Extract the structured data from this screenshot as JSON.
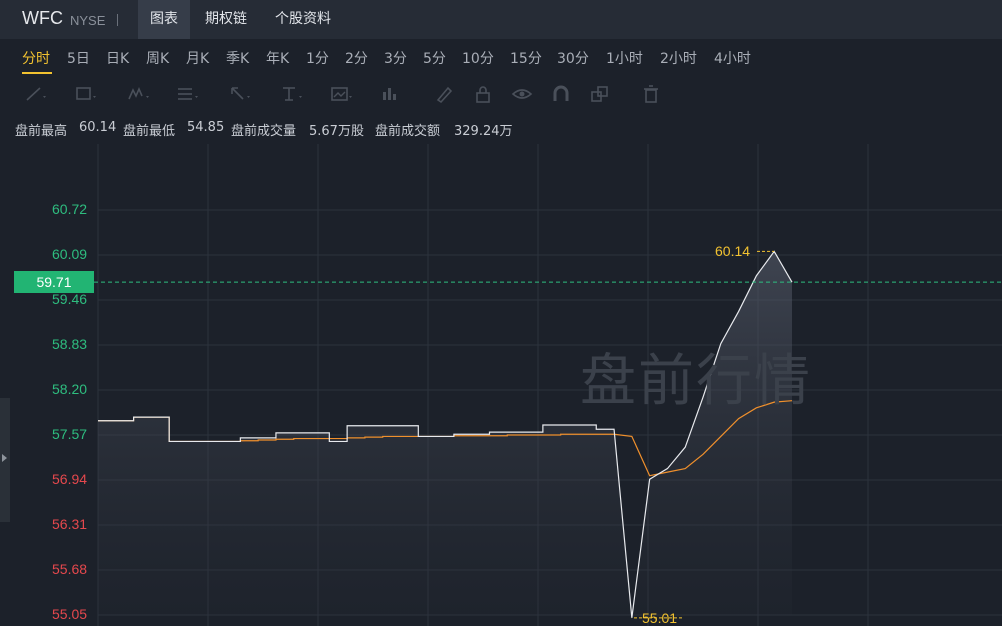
{
  "header": {
    "ticker": "WFC",
    "exchange": "NYSE",
    "tabs": [
      {
        "label": "图表",
        "active": true
      },
      {
        "label": "期权链",
        "active": false
      },
      {
        "label": "个股资料",
        "active": false
      }
    ]
  },
  "periods": [
    "分时",
    "5日",
    "日K",
    "周K",
    "月K",
    "季K",
    "年K",
    "1分",
    "2分",
    "3分",
    "5分",
    "10分",
    "15分",
    "30分",
    "1小时",
    "2小时",
    "4小时"
  ],
  "active_period": "分时",
  "toolbar_icons": [
    "line-tool-icon",
    "rectangle-tool-icon",
    "wave-tool-icon",
    "fibonacci-tool-icon",
    "arrow-tool-icon",
    "text-tool-icon",
    "image-tool-icon",
    "measure-tool-icon",
    "brush-icon",
    "lock-icon",
    "eye-icon",
    "magnet-icon",
    "layers-icon",
    "trash-icon"
  ],
  "stats": {
    "high_label": "盘前最高",
    "high_value": "60.14",
    "low_label": "盘前最低",
    "low_value": "54.85",
    "volume_label": "盘前成交量",
    "volume_value": "5.67万股",
    "amount_label": "盘前成交额",
    "amount_value": "329.24万"
  },
  "chart": {
    "watermark": "盘前行情",
    "current_price": "59.71",
    "high_marker": "60.14",
    "low_marker": "55.01",
    "y_ticks": [
      "60.72",
      "60.09",
      "59.46",
      "58.83",
      "58.20",
      "57.57",
      "56.94",
      "56.31",
      "55.68",
      "55.05"
    ],
    "colors": {
      "up": "#2ebd7f",
      "down": "#e5484d",
      "price_line": "#e8eaee",
      "avg_line": "#f0902c",
      "marker": "#f2c230",
      "grid": "#2c323c"
    }
  },
  "chart_data": {
    "type": "line",
    "title": "",
    "xlabel": "",
    "ylabel": "",
    "ylim": [
      55.05,
      60.72
    ],
    "series": [
      {
        "name": "",
        "values": [
          57.77,
          57.77,
          57.82,
          57.82,
          57.48,
          57.48,
          57.48,
          57.48,
          57.53,
          57.53,
          57.6,
          57.6,
          57.6,
          57.48,
          57.7,
          57.7,
          57.7,
          57.7,
          57.55,
          57.55,
          57.58,
          57.58,
          57.61,
          57.61,
          57.61,
          57.71,
          57.71,
          57.71,
          57.65,
          57.65,
          55.01,
          56.95,
          57.1,
          57.4,
          58.1,
          58.85,
          59.3,
          59.8,
          60.14,
          59.71
        ]
      },
      {
        "name": "",
        "values": [
          57.77,
          57.77,
          57.82,
          57.82,
          57.48,
          57.48,
          57.48,
          57.48,
          57.49,
          57.5,
          57.51,
          57.52,
          57.52,
          57.52,
          57.53,
          57.54,
          57.55,
          57.55,
          57.55,
          57.55,
          57.56,
          57.56,
          57.56,
          57.57,
          57.57,
          57.57,
          57.58,
          57.58,
          57.58,
          57.58,
          57.55,
          57.0,
          57.05,
          57.1,
          57.3,
          57.55,
          57.8,
          57.95,
          58.03,
          58.05
        ]
      }
    ]
  }
}
